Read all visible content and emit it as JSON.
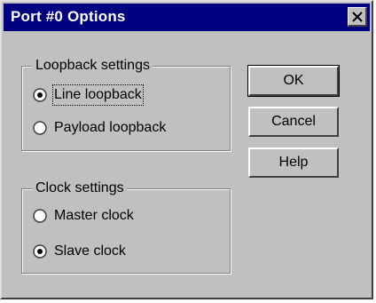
{
  "window": {
    "title": "Port #0 Options"
  },
  "loopback": {
    "legend": "Loopback settings",
    "options": [
      {
        "label": "Line loopback",
        "selected": true
      },
      {
        "label": "Payload loopback",
        "selected": false
      }
    ]
  },
  "clock": {
    "legend": "Clock settings",
    "options": [
      {
        "label": "Master clock",
        "selected": false
      },
      {
        "label": "Slave clock",
        "selected": true
      }
    ]
  },
  "buttons": {
    "ok": "OK",
    "cancel": "Cancel",
    "help": "Help"
  },
  "colors": {
    "titlebar": "#000080",
    "face": "#c0c0c0"
  }
}
